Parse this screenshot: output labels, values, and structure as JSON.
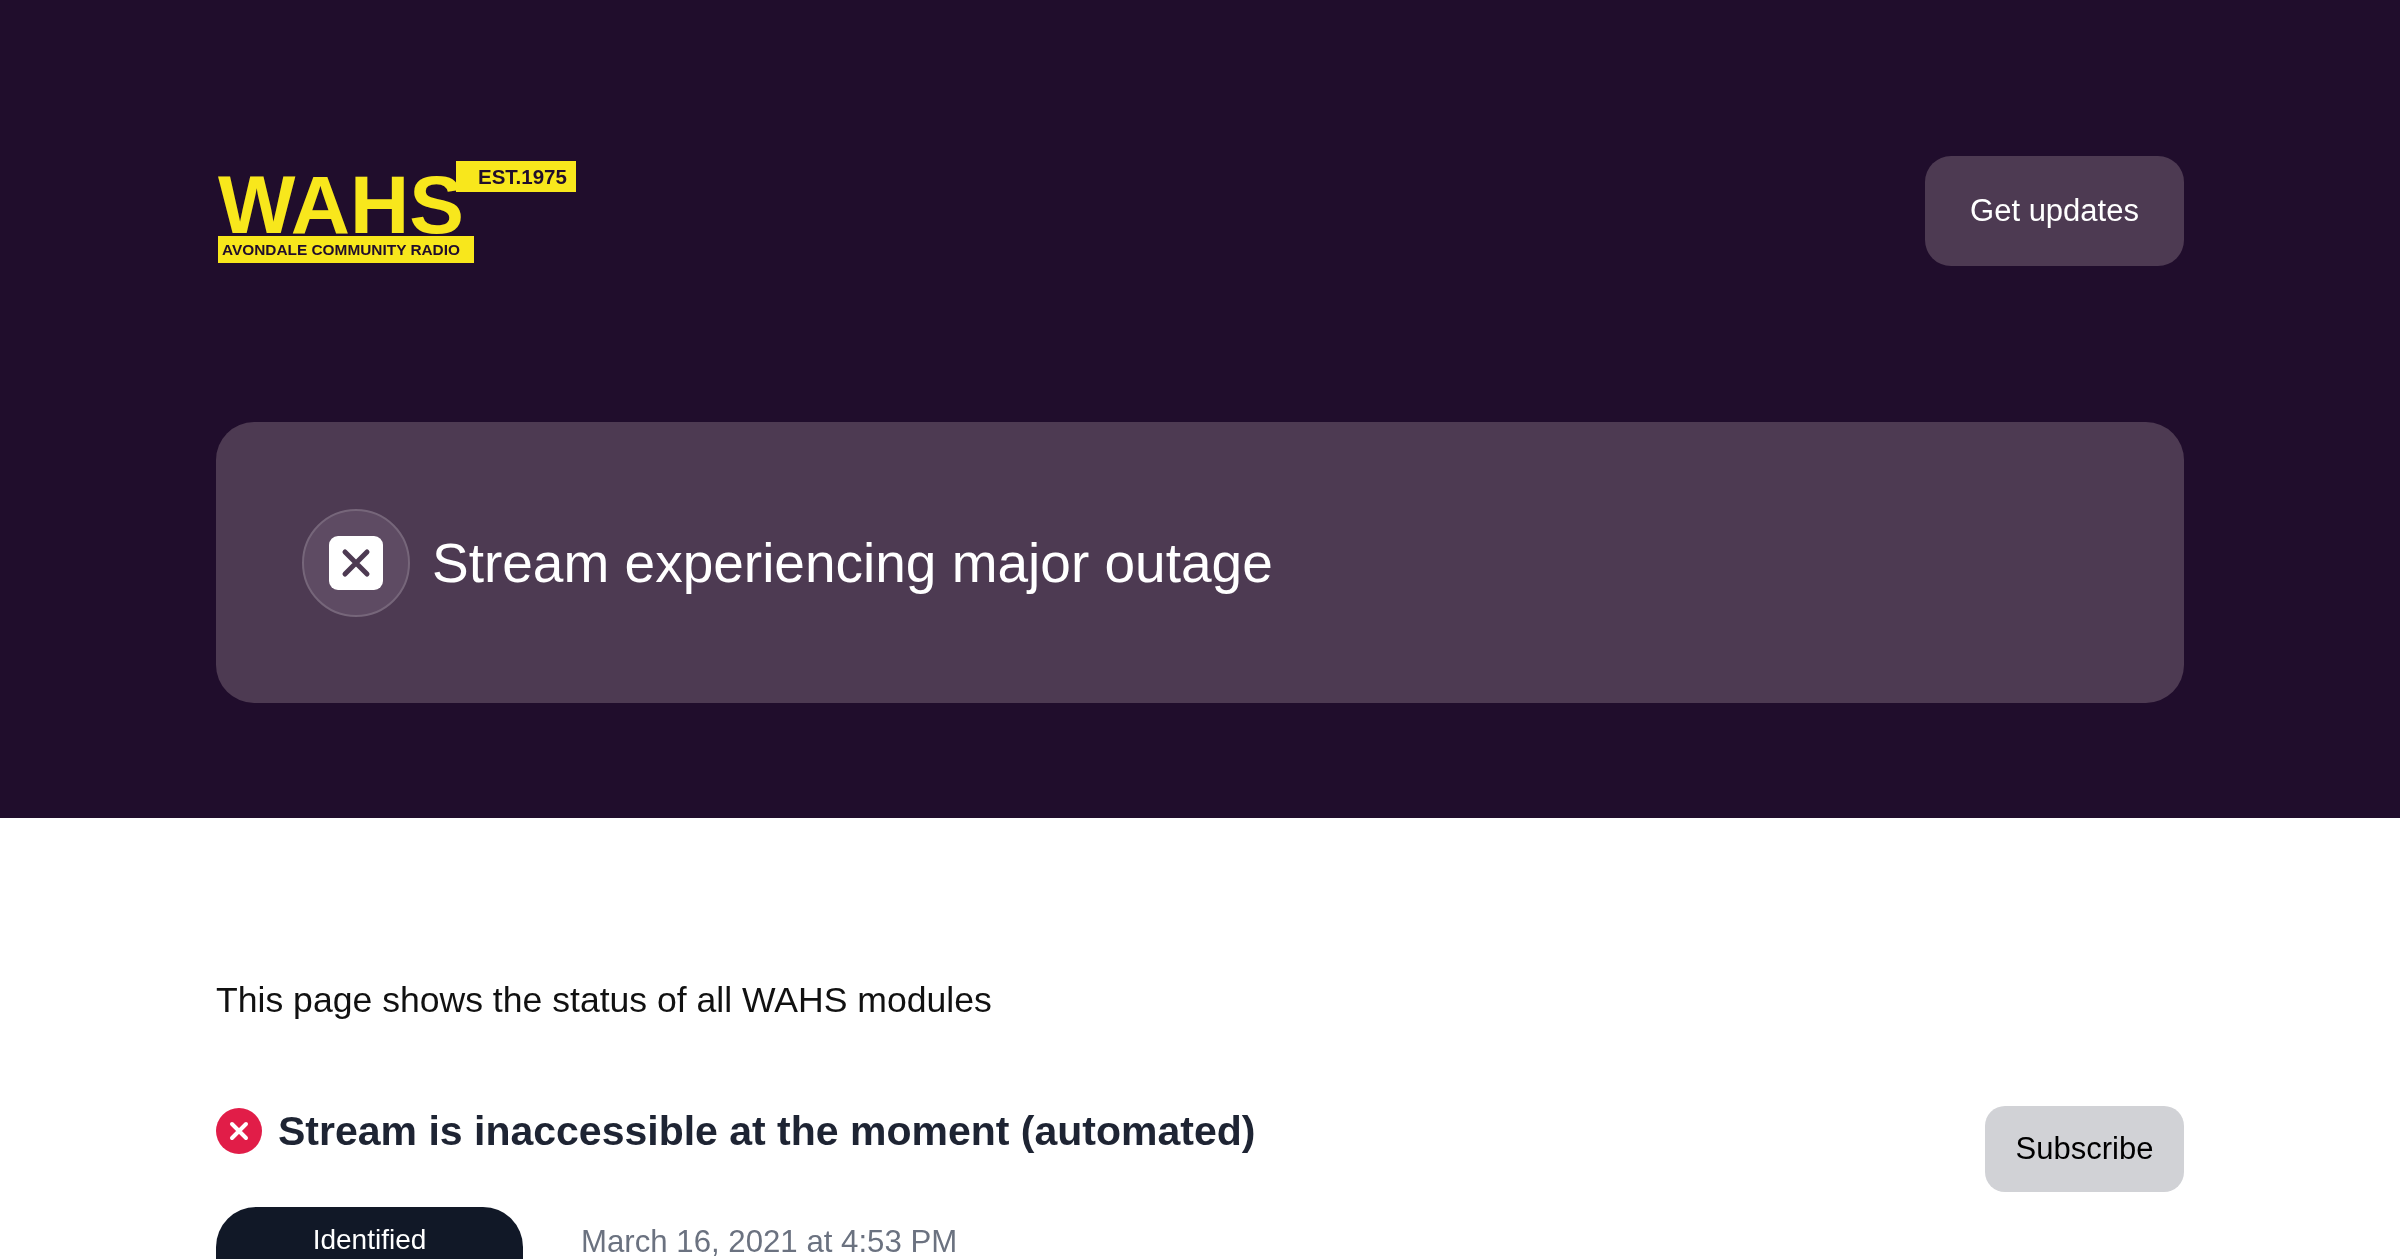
{
  "header": {
    "logo": {
      "wordmark": "WAHS",
      "established": "EST.1975",
      "tagline": "AVONDALE COMMUNITY RADIO"
    },
    "button": "Get updates"
  },
  "status_banner": {
    "kind": "major_outage",
    "title": "Stream experiencing major outage"
  },
  "intro": "This page shows the status of all WAHS modules",
  "incidents": [
    {
      "kind": "major",
      "title": "Stream is inaccessible at the moment (automated)",
      "subscribe_button": "Subscribe",
      "status": "Identified",
      "time": "March 16, 2021 at 4:53 PM"
    }
  ]
}
